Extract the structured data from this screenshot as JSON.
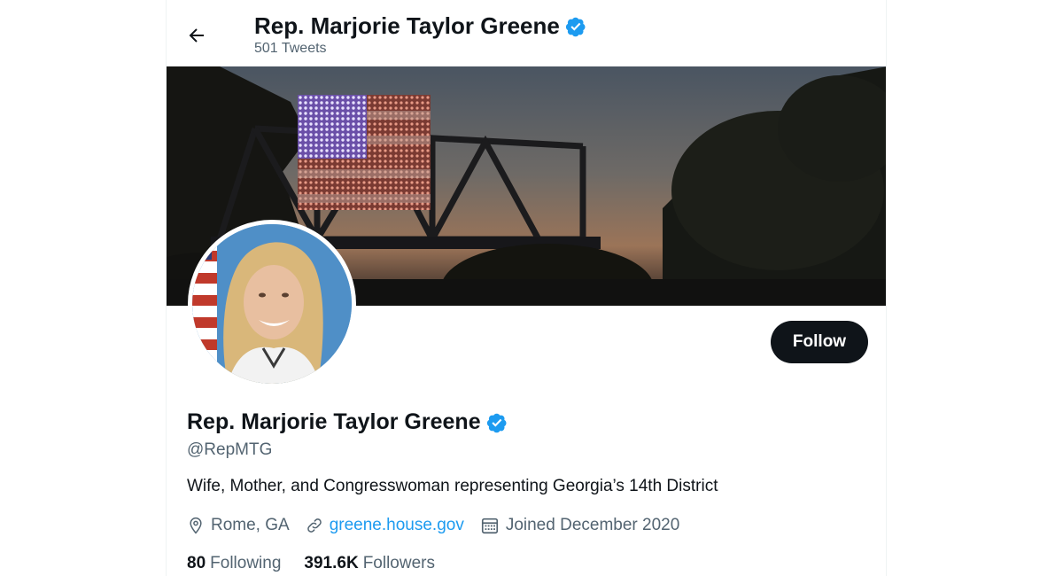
{
  "header": {
    "name": "Rep. Marjorie Taylor Greene",
    "tweet_count": "501 Tweets"
  },
  "profile": {
    "name": "Rep. Marjorie Taylor Greene",
    "handle": "@RepMTG",
    "bio": "Wife, Mother, and Congresswoman representing Georgia’s 14th District",
    "location": "Rome, GA",
    "website": "greene.house.gov",
    "joined": "Joined December 2020",
    "following_count": "80",
    "following_label": "Following",
    "followers_count": "391.6K",
    "followers_label": "Followers"
  },
  "actions": {
    "follow_label": "Follow"
  },
  "icons": {
    "back": "arrow-left-icon",
    "verified": "verified-badge-icon",
    "location": "location-pin-icon",
    "link": "link-icon",
    "calendar": "calendar-icon"
  },
  "colors": {
    "accent": "#1d9bf0",
    "text": "#0f1419",
    "secondary": "#536471",
    "button": "#0f1419"
  }
}
